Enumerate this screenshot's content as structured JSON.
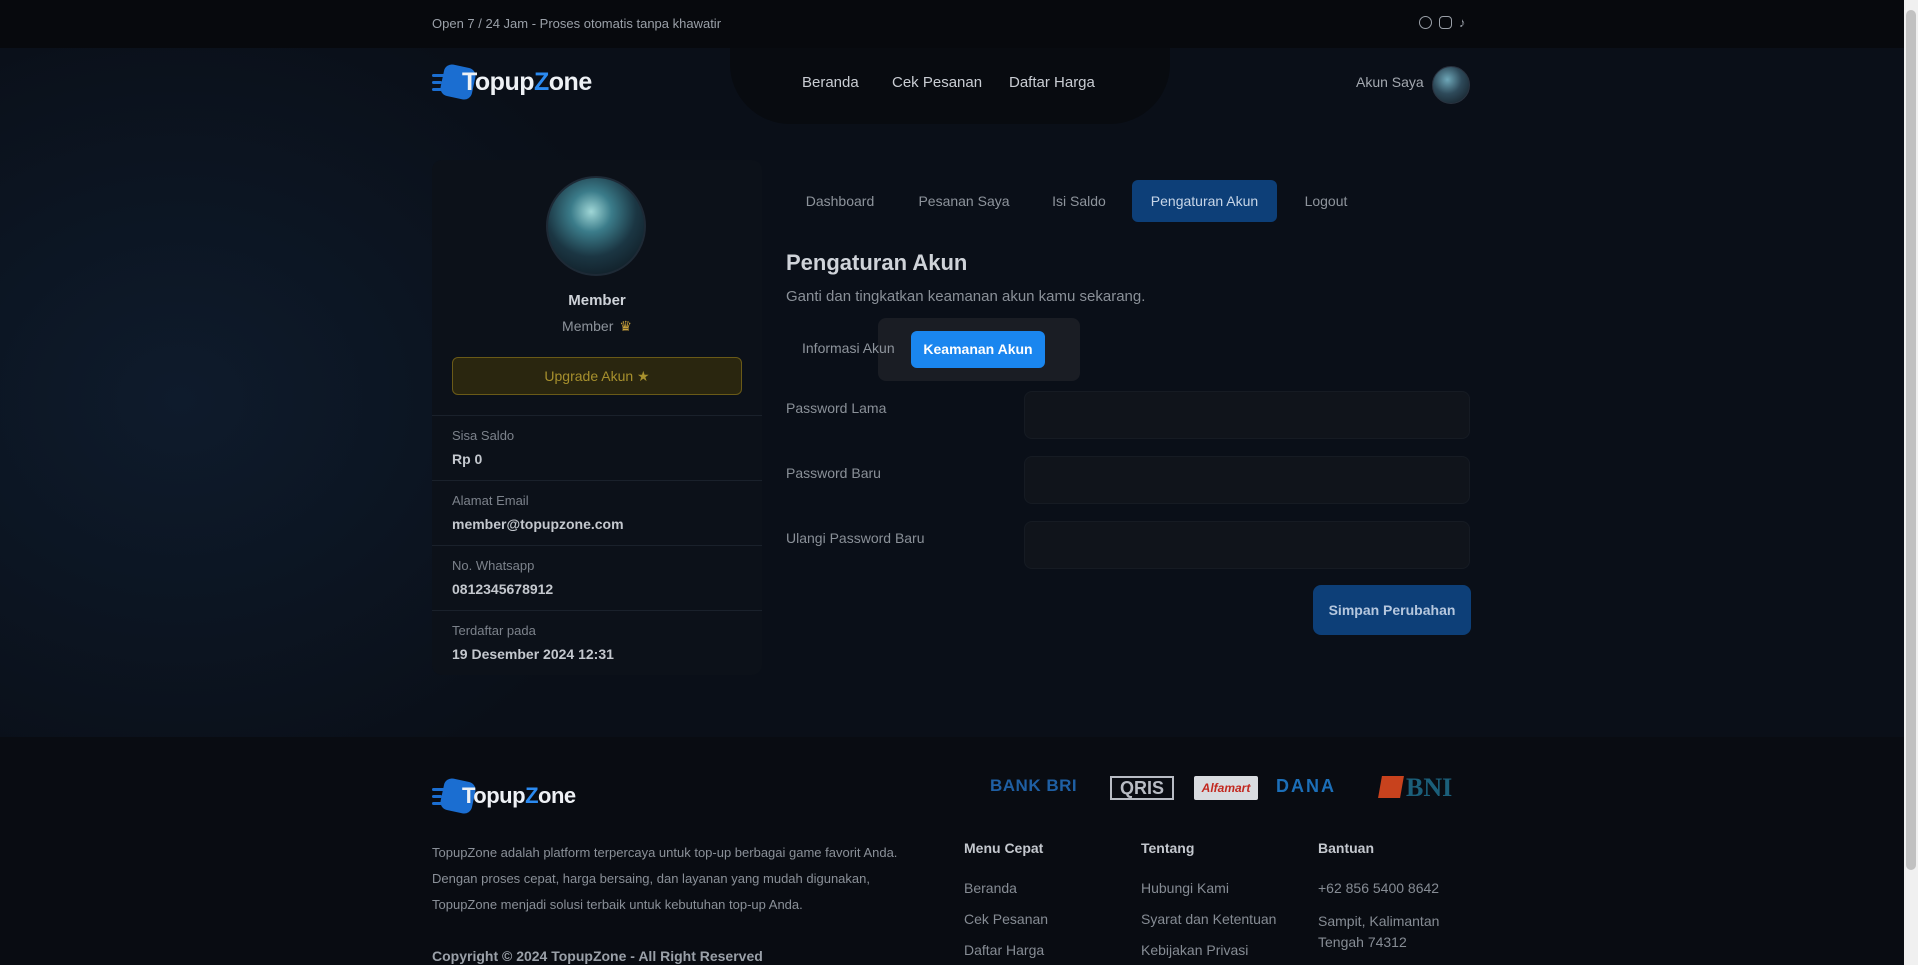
{
  "topbar": {
    "tagline": "Open 7 / 24 Jam - Proses otomatis tanpa khawatir",
    "social_icons": [
      "whatsapp-icon",
      "instagram-icon",
      "tiktok-icon"
    ]
  },
  "brand": {
    "name_part1": "Topup",
    "name_part2": "Z",
    "name_part3": "one",
    "accent": "#2b8af0"
  },
  "nav": {
    "items": [
      "Beranda",
      "Cek Pesanan",
      "Daftar Harga"
    ],
    "account_label": "Akun Saya"
  },
  "profile": {
    "name": "Member",
    "level": "Member",
    "upgrade_label": "Upgrade Akun",
    "fields": [
      {
        "label": "Sisa Saldo",
        "value": "Rp 0"
      },
      {
        "label": "Alamat Email",
        "value": "member@topupzone.com"
      },
      {
        "label": "No. Whatsapp",
        "value": "0812345678912"
      },
      {
        "label": "Terdaftar pada",
        "value": "19 Desember 2024 12:31"
      }
    ]
  },
  "tabs": {
    "items": [
      "Dashboard",
      "Pesanan Saya",
      "Isi Saldo",
      "Pengaturan Akun",
      "Logout"
    ],
    "active": "Pengaturan Akun"
  },
  "settings": {
    "title": "Pengaturan Akun",
    "subtitle": "Ganti dan tingkatkan keamanan akun kamu sekarang.",
    "subtabs": {
      "inactive": "Informasi Akun",
      "active": "Keamanan Akun"
    },
    "fields": [
      {
        "label": "Password Lama",
        "value": ""
      },
      {
        "label": "Password Baru",
        "value": ""
      },
      {
        "label": "Ulangi Password Baru",
        "value": ""
      }
    ],
    "save_label": "Simpan Perubahan"
  },
  "footer": {
    "description": "TopupZone adalah platform terpercaya untuk top-up berbagai game favorit Anda. Dengan proses cepat, harga bersaing, dan layanan yang mudah digunakan, TopupZone menjadi solusi terbaik untuk kebutuhan top-up Anda.",
    "copyright": "Copyright © 2024 TopupZone - All Right Reserved",
    "payments": [
      "BANK BRI",
      "QRIS",
      "Alfamart",
      "DANA",
      "BNI"
    ],
    "columns": [
      {
        "title": "Menu Cepat",
        "links": [
          "Beranda",
          "Cek Pesanan",
          "Daftar Harga"
        ]
      },
      {
        "title": "Tentang",
        "links": [
          "Hubungi Kami",
          "Syarat dan Ketentuan",
          "Kebijakan Privasi"
        ]
      },
      {
        "title": "Bantuan",
        "links": [
          "+62 856 5400 8642",
          "Sampit, Kalimantan Tengah 74312"
        ]
      }
    ]
  }
}
